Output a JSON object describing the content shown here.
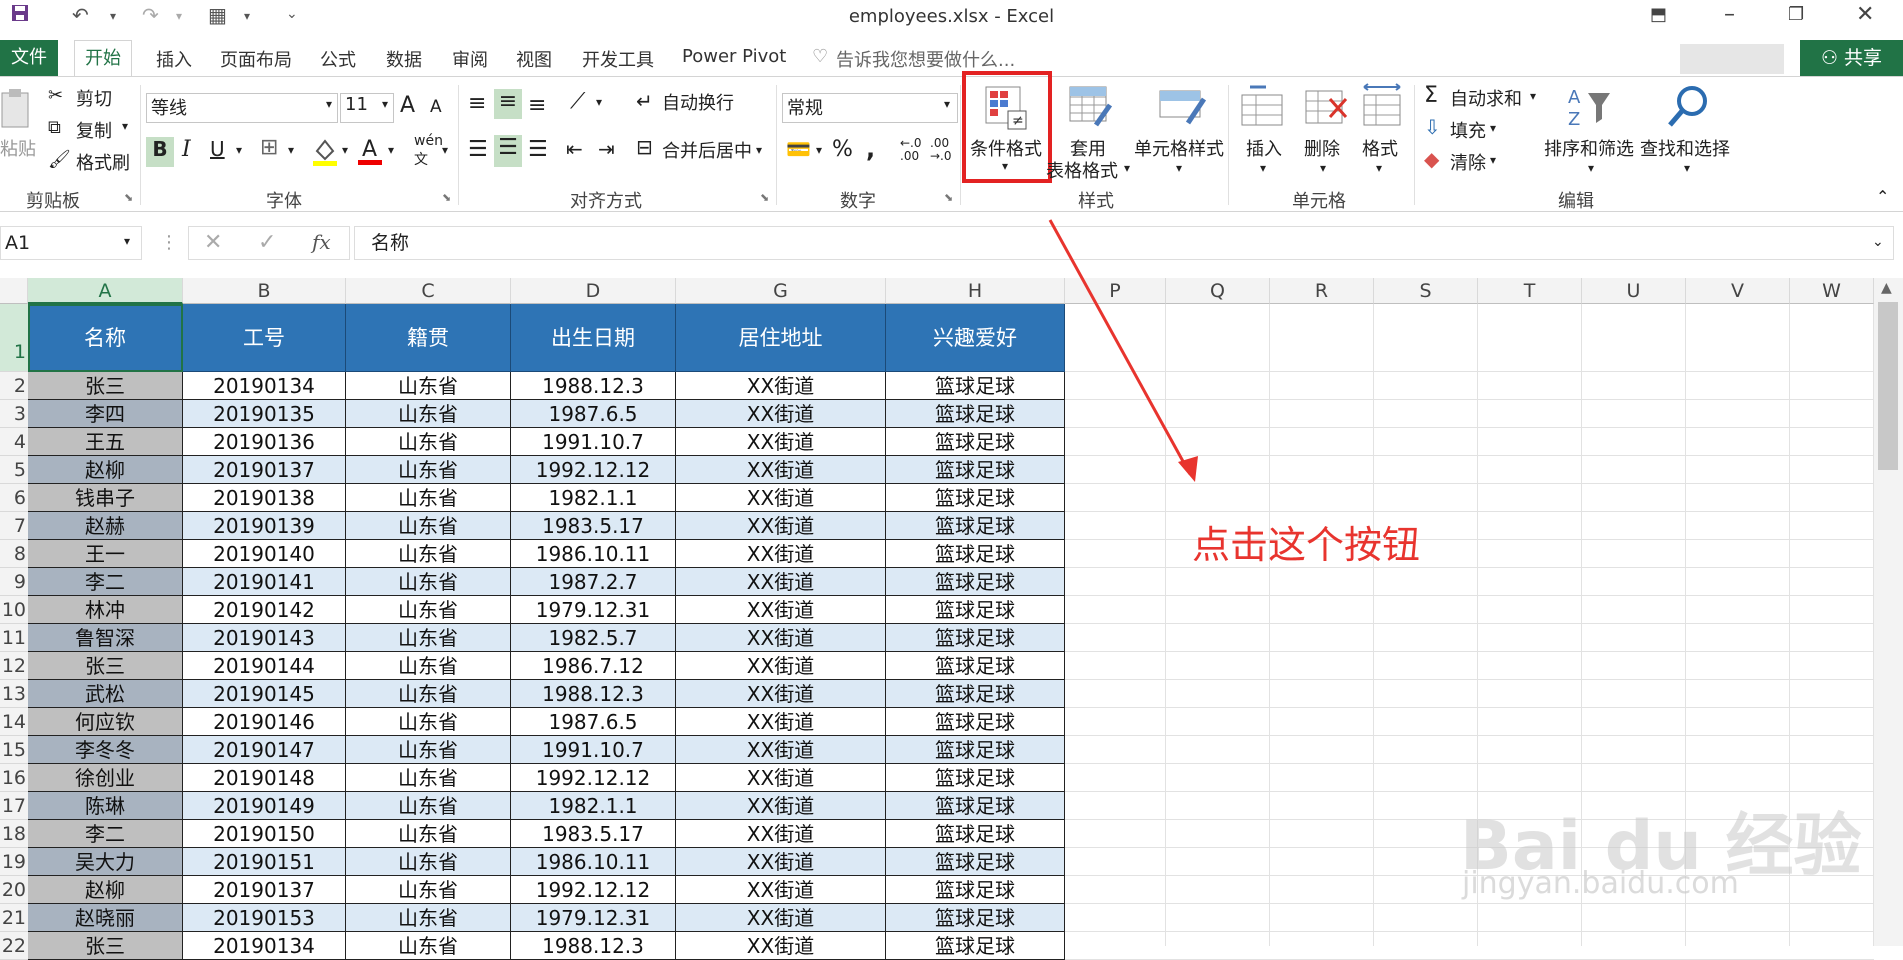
{
  "window": {
    "title": "employees.xlsx - Excel"
  },
  "tabs": [
    "文件",
    "开始",
    "插入",
    "页面布局",
    "公式",
    "数据",
    "审阅",
    "视图",
    "开发工具",
    "Power Pivot"
  ],
  "tell_me": "告诉我您想要做什么...",
  "share": "共享",
  "ribbon": {
    "clipboard": {
      "paste": "粘贴",
      "cut": "剪切",
      "copy": "复制",
      "format_painter": "格式刷",
      "group": "剪贴板"
    },
    "font": {
      "name": "等线",
      "size": "11",
      "bold": "B",
      "italic": "I",
      "underline": "U",
      "group": "字体",
      "grow": "A",
      "shrink": "A"
    },
    "alignment": {
      "wrap": "自动换行",
      "merge": "合并后居中",
      "group": "对齐方式"
    },
    "number": {
      "format": "常规",
      "percent": "%",
      "comma": ",",
      "group": "数字"
    },
    "styles": {
      "conditional": "条件格式",
      "table_format_1": "套用",
      "table_format_2": "表格格式",
      "cell_styles": "单元格样式",
      "group": "样式"
    },
    "cells": {
      "insert": "插入",
      "delete": "删除",
      "format": "格式",
      "group": "单元格"
    },
    "editing": {
      "autosum": "自动求和",
      "fill": "填充",
      "clear": "清除",
      "sort": "排序和筛选",
      "find": "查找和选择",
      "group": "编辑"
    }
  },
  "formula_bar": {
    "name_box": "A1",
    "fx": "fx",
    "value": "名称"
  },
  "columns": [
    "A",
    "B",
    "C",
    "D",
    "G",
    "H",
    "P",
    "Q",
    "R",
    "S",
    "T",
    "U",
    "V",
    "W"
  ],
  "rows": [
    "1",
    "2",
    "3",
    "4",
    "5",
    "6",
    "7",
    "8",
    "9",
    "10",
    "11",
    "12",
    "13",
    "14",
    "15",
    "16",
    "17",
    "18",
    "19",
    "20",
    "21",
    "22"
  ],
  "headers": [
    "名称",
    "工号",
    "籍贯",
    "出生日期",
    "居住地址",
    "兴趣爱好"
  ],
  "records": [
    [
      "张三",
      "20190134",
      "山东省",
      "1988.12.3",
      "XX街道",
      "篮球足球"
    ],
    [
      "李四",
      "20190135",
      "山东省",
      "1987.6.5",
      "XX街道",
      "篮球足球"
    ],
    [
      "王五",
      "20190136",
      "山东省",
      "1991.10.7",
      "XX街道",
      "篮球足球"
    ],
    [
      "赵柳",
      "20190137",
      "山东省",
      "1992.12.12",
      "XX街道",
      "篮球足球"
    ],
    [
      "钱串子",
      "20190138",
      "山东省",
      "1982.1.1",
      "XX街道",
      "篮球足球"
    ],
    [
      "赵赫",
      "20190139",
      "山东省",
      "1983.5.17",
      "XX街道",
      "篮球足球"
    ],
    [
      "王一",
      "20190140",
      "山东省",
      "1986.10.11",
      "XX街道",
      "篮球足球"
    ],
    [
      "李二",
      "20190141",
      "山东省",
      "1987.2.7",
      "XX街道",
      "篮球足球"
    ],
    [
      "林冲",
      "20190142",
      "山东省",
      "1979.12.31",
      "XX街道",
      "篮球足球"
    ],
    [
      "鲁智深",
      "20190143",
      "山东省",
      "1982.5.7",
      "XX街道",
      "篮球足球"
    ],
    [
      "张三",
      "20190144",
      "山东省",
      "1986.7.12",
      "XX街道",
      "篮球足球"
    ],
    [
      "武松",
      "20190145",
      "山东省",
      "1988.12.3",
      "XX街道",
      "篮球足球"
    ],
    [
      "何应钦",
      "20190146",
      "山东省",
      "1987.6.5",
      "XX街道",
      "篮球足球"
    ],
    [
      "李冬冬",
      "20190147",
      "山东省",
      "1991.10.7",
      "XX街道",
      "篮球足球"
    ],
    [
      "徐创业",
      "20190148",
      "山东省",
      "1992.12.12",
      "XX街道",
      "篮球足球"
    ],
    [
      "陈琳",
      "20190149",
      "山东省",
      "1982.1.1",
      "XX街道",
      "篮球足球"
    ],
    [
      "李二",
      "20190150",
      "山东省",
      "1983.5.17",
      "XX街道",
      "篮球足球"
    ],
    [
      "吴大力",
      "20190151",
      "山东省",
      "1986.10.11",
      "XX街道",
      "篮球足球"
    ],
    [
      "赵柳",
      "20190137",
      "山东省",
      "1992.12.12",
      "XX街道",
      "篮球足球"
    ],
    [
      "赵晓丽",
      "20190153",
      "山东省",
      "1979.12.31",
      "XX街道",
      "篮球足球"
    ],
    [
      "张三",
      "20190134",
      "山东省",
      "1988.12.3",
      "XX街道",
      "篮球足球"
    ]
  ],
  "annotation": {
    "text": "点击这个按钮",
    "color": "#e8342e"
  },
  "watermark": {
    "brand": "Bai du 经验",
    "url": "jingyan.baidu.com"
  },
  "colors": {
    "excel_green": "#217346",
    "header_blue": "#2e74b5",
    "row_band": "#dce9f5",
    "name_gray": "#bfbfbf",
    "name_gray_dark": "#a8b3c0"
  }
}
